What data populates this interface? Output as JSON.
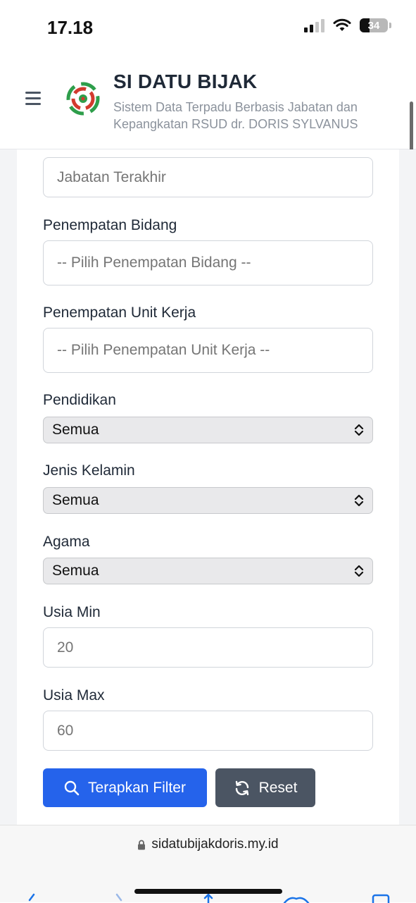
{
  "status_bar": {
    "time": "17.18",
    "battery": "34"
  },
  "header": {
    "title": "SI DATU BIJAK",
    "subtitle": "Sistem Data Terpadu Berbasis Jabatan dan Kepangkatan RSUD dr. DORIS SYLVANUS"
  },
  "form": {
    "jabatan_terakhir": {
      "placeholder": "Jabatan Terakhir"
    },
    "penempatan_bidang": {
      "label": "Penempatan Bidang",
      "placeholder": "-- Pilih Penempatan Bidang --"
    },
    "penempatan_unit_kerja": {
      "label": "Penempatan Unit Kerja",
      "placeholder": "-- Pilih Penempatan Unit Kerja --"
    },
    "pendidikan": {
      "label": "Pendidikan",
      "value": "Semua"
    },
    "jenis_kelamin": {
      "label": "Jenis Kelamin",
      "value": "Semua"
    },
    "agama": {
      "label": "Agama",
      "value": "Semua"
    },
    "usia_min": {
      "label": "Usia Min",
      "placeholder": "20"
    },
    "usia_max": {
      "label": "Usia Max",
      "placeholder": "60"
    }
  },
  "buttons": {
    "apply_label": "Terapkan Filter",
    "reset_label": "Reset"
  },
  "browser": {
    "url": "sidatubijakdoris.my.id"
  },
  "colors": {
    "primary": "#2563eb",
    "secondary": "#4b5563"
  }
}
